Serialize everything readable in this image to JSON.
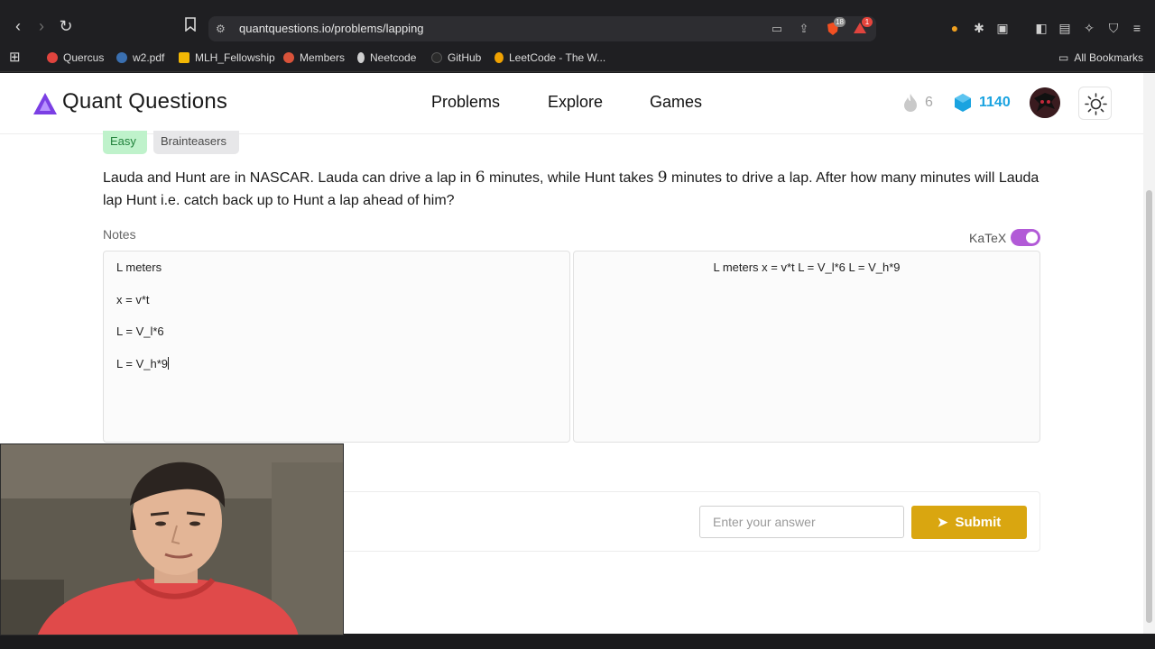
{
  "browser": {
    "url": "quantquestions.io/problems/lapping",
    "extensions": {
      "brave_count": "18",
      "alert_count": "1"
    },
    "bookmarks": [
      {
        "label": "Quercus",
        "color": "#e0443e"
      },
      {
        "label": "w2.pdf",
        "color": "#3a6fb0"
      },
      {
        "label": "MLH_Fellowship",
        "color": "#f2b705"
      },
      {
        "label": "Members",
        "color": "#d9533a"
      },
      {
        "label": "Neetcode",
        "color": "#cfcfcf"
      },
      {
        "label": "GitHub",
        "color": "#2b2b2b"
      },
      {
        "label": "LeetCode - The W...",
        "color": "#f0a202"
      }
    ],
    "all_bookmarks_label": "All Bookmarks"
  },
  "site": {
    "brand": "Quant Questions",
    "brand_color": "#7b3fe4",
    "nav": [
      "Problems",
      "Explore",
      "Games"
    ],
    "streak_count": "6",
    "gem_count": "1140"
  },
  "problem": {
    "tags": [
      "Easy",
      "Brainteasers"
    ],
    "text_part1": "Lauda and Hunt are in NASCAR. Lauda can drive a lap in ",
    "num1": "6",
    "text_part2": " minutes, while Hunt takes ",
    "num2": "9",
    "text_part3": " minutes to drive a lap. After how many minutes will Lauda lap Hunt i.e. catch back up to Hunt a lap ahead of him?"
  },
  "notes": {
    "label": "Notes",
    "katex_label": "KaTeX",
    "katex_enabled": true,
    "lines": [
      "L meters",
      "x = v*t",
      "L = V_l*6",
      "L = V_h*9"
    ],
    "preview": "L meters x = v*t L = V_l*6 L = V_h*9"
  },
  "answer": {
    "placeholder": "Enter your answer",
    "submit_label": "Submit",
    "submit_color": "#d9a610"
  }
}
